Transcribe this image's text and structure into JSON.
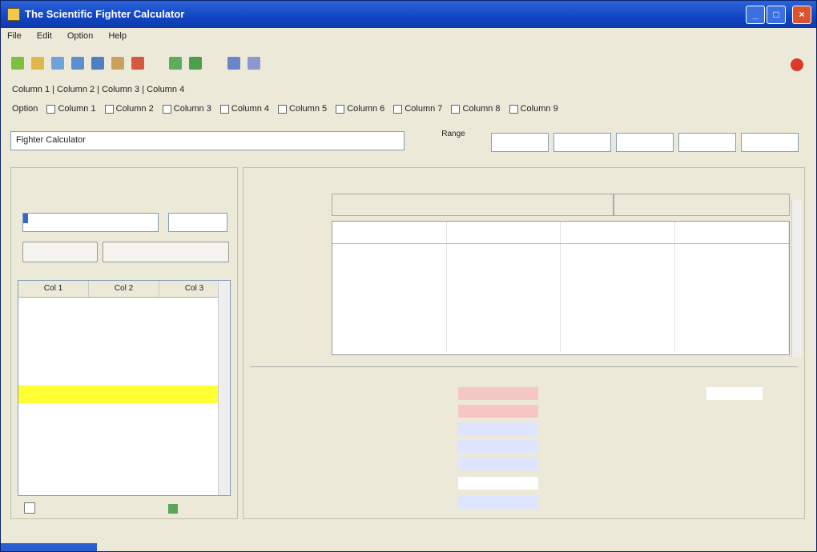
{
  "window": {
    "title": "The Scientific Fighter Calculator",
    "min": "_",
    "max": "□",
    "close": "×"
  },
  "menu": [
    "File",
    "Edit",
    "Option",
    "Help"
  ],
  "toolbar": {
    "icons": [
      "new-icon",
      "open-icon",
      "save-icon",
      "print-icon",
      "copy-icon",
      "paste-icon",
      "edit-icon",
      "chart-icon",
      "table-icon",
      "up-arrow-icon",
      "down-arrow-icon"
    ]
  },
  "row1": "Column 1 | Column 2 | Column 3 | Column 4",
  "row2": {
    "lead": "Option",
    "checks": [
      "Column 1",
      "Column 2",
      "Column 3",
      "Column 4",
      "Column 5",
      "Column 6",
      "Column 7",
      "Column 8",
      "Column 9"
    ]
  },
  "search": {
    "value": "Fighter Calculator"
  },
  "range": {
    "label": "Range",
    "fields": [
      "",
      "",
      "",
      "",
      ""
    ]
  },
  "left": {
    "title": "",
    "l1": "",
    "l2": "",
    "input_value": "",
    "input2_value": "",
    "btn1": "",
    "btn2": "",
    "grid_headers": [
      "Col 1",
      "Col 2",
      "Col 3"
    ],
    "rows": [
      [
        "",
        "",
        ""
      ],
      [
        "",
        "",
        ""
      ],
      [
        "",
        "",
        ""
      ],
      [
        "",
        "",
        ""
      ],
      [
        "",
        "",
        ""
      ],
      [
        "",
        "",
        ""
      ]
    ],
    "foot1": "",
    "foot2": ""
  },
  "right": {
    "title": "",
    "g1": "",
    "g2": "",
    "row_header": "",
    "cols": [
      "",
      "",
      "",
      ""
    ],
    "row_labels": [
      "",
      "",
      "",
      "",
      ""
    ],
    "rows": [
      [
        "",
        "",
        "",
        ""
      ],
      [
        "",
        "",
        "",
        ""
      ],
      [
        "",
        "",
        "",
        ""
      ],
      [
        "",
        "",
        "",
        ""
      ],
      [
        "",
        "",
        "",
        ""
      ]
    ]
  },
  "stats": [
    {
      "label": "",
      "value": "",
      "color": "#f6c6c6"
    },
    {
      "label": "",
      "value": "",
      "color": "#f6c6c6"
    },
    {
      "label": "",
      "value": "",
      "color": "#dfe4ff"
    },
    {
      "label": "",
      "value": "",
      "color": "#dfe4ff"
    },
    {
      "label": "",
      "value": "",
      "color": "#dfe4ff"
    },
    {
      "label": "",
      "value": "",
      "color": "#ffffff"
    },
    {
      "label": "",
      "value": "",
      "color": "#dfe4ff"
    }
  ],
  "side_stats": [
    {
      "label": "",
      "value": ""
    },
    {
      "label": "",
      "value": ""
    }
  ]
}
